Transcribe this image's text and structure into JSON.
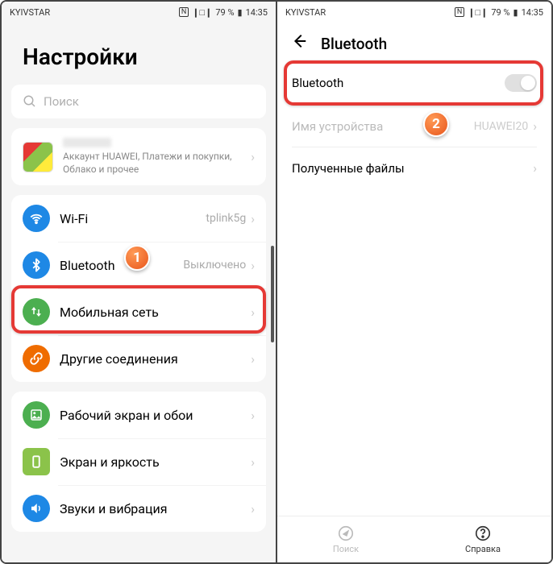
{
  "statusbar": {
    "carrier": "KYIVSTAR",
    "battery_pct": "79 %",
    "time": "14:35",
    "nfc": "NFC"
  },
  "left": {
    "title": "Настройки",
    "search_placeholder": "Поиск",
    "account_sub": "Аккаунт HUAWEI, Платежи и покупки, Облако и прочее",
    "items": [
      {
        "label": "Wi-Fi",
        "value": "tplink5g",
        "color": "#1e88e5",
        "icon": "wifi"
      },
      {
        "label": "Bluetooth",
        "value": "Выключено",
        "color": "#1e88e5",
        "icon": "bt"
      },
      {
        "label": "Мобильная сеть",
        "value": "",
        "color": "#4caf50",
        "icon": "mobile"
      },
      {
        "label": "Другие соединения",
        "value": "",
        "color": "#ef6c00",
        "icon": "link"
      }
    ],
    "items2": [
      {
        "label": "Рабочий экран и обои",
        "color": "#4caf50",
        "icon": "home"
      },
      {
        "label": "Экран и яркость",
        "color": "#8bc34a",
        "icon": "brightness"
      },
      {
        "label": "Звуки и вибрация",
        "color": "#1e88e5",
        "icon": "sound"
      }
    ]
  },
  "right": {
    "title": "Bluetooth",
    "toggle_label": "Bluetooth",
    "device_name_label": "Имя устройства",
    "device_name_value": "HUAWEI20",
    "received_files": "Полученные файлы",
    "nav_search": "Поиск",
    "nav_help": "Справка"
  },
  "callouts": {
    "one": "1",
    "two": "2"
  }
}
